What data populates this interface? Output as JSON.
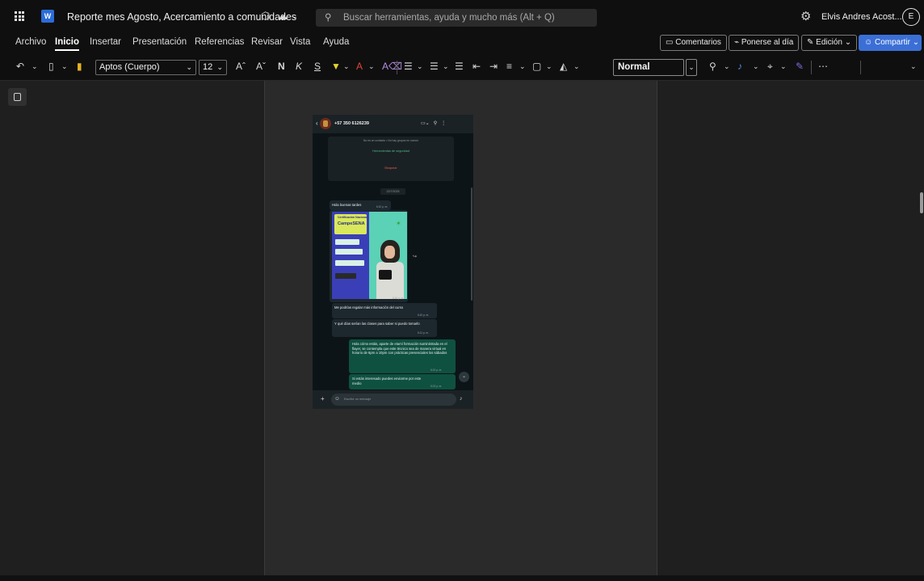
{
  "titlebar": {
    "doc_title": "Reporte mes Agosto, Acercamiento a comunidades",
    "app_letter": "W",
    "search_placeholder": "Buscar herramientas, ayuda y mucho más (Alt + Q)",
    "user_name": "Elvis Andres Acost...",
    "user_initial": "E"
  },
  "menu": {
    "tabs": [
      "Archivo",
      "Inicio",
      "Insertar",
      "Presentación",
      "Referencias",
      "Revisar",
      "Vista",
      "Ayuda"
    ],
    "active_tab": "Inicio",
    "comments": "Comentarios",
    "catch_up": "Ponerse al día",
    "editing": "Edición",
    "share": "Compartir"
  },
  "ribbon": {
    "font_name": "Aptos (Cuerpo)",
    "font_size": "12",
    "bold": "N",
    "italic": "K",
    "underline": "S",
    "style": "Normal"
  },
  "phone_screenshot": {
    "contact": "+57 350 6126239",
    "info_line": "No es un contacto • No hay grupos en común",
    "security_tools": "Herramientas de seguridad",
    "block": "Bloquear",
    "date_chip": "22/7/2025",
    "messages": [
      {
        "dir": "in",
        "text": "Hola buenas tardes",
        "time": "6:10 p. m."
      },
      {
        "dir": "in",
        "text": "Me podrías regalar más información del curso",
        "time": "6:10 p. m."
      },
      {
        "dir": "in",
        "text": "Y qué días serían las clases para saber si puedo tomarlo",
        "time": "6:11 p. m."
      },
      {
        "dir": "out",
        "text": "Hola cómo estás, aparte de etamí formación suministrada en el flayer, se contempla que este técnico sea de manera virtual en horario de 6pm a 10pm con prácticas presenciales los sábados",
        "time": "6:13 p. m."
      },
      {
        "dir": "out",
        "text": "Si estás interesado puedes enviarme por este medio",
        "time": "6:13 p. m."
      }
    ],
    "flyer": {
      "line1": "Certificación Nacional",
      "line2": "CampeSENA",
      "time": "6:10 p. m."
    },
    "input_placeholder": "Escribe un mensaje"
  }
}
